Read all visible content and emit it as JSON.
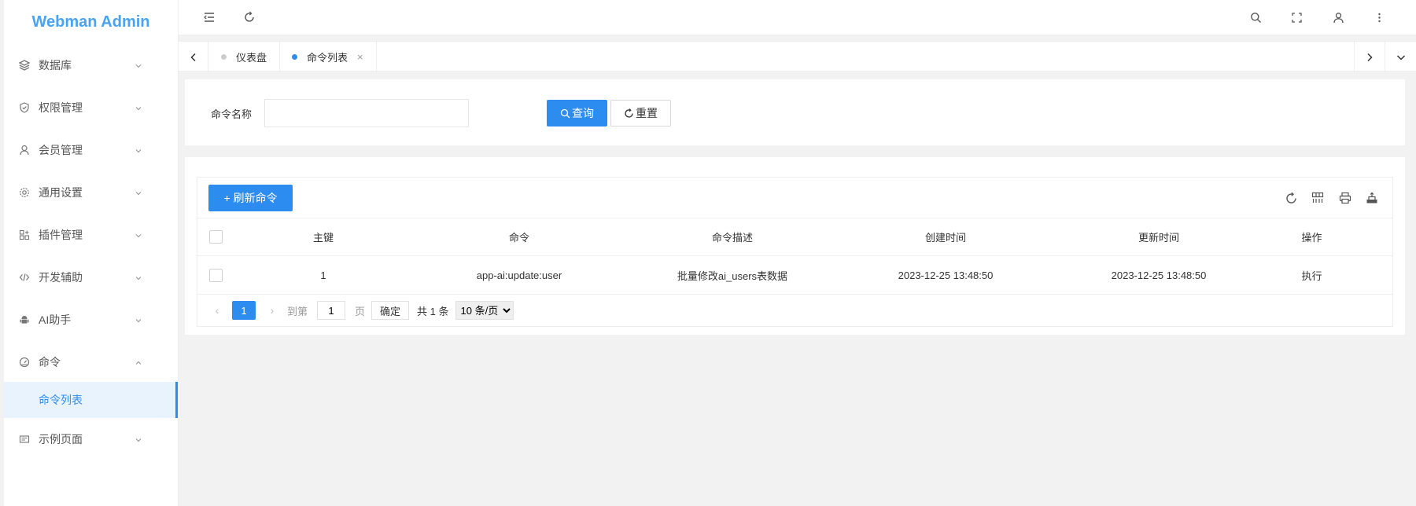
{
  "app": {
    "title": "Webman Admin"
  },
  "sidebar": {
    "items": [
      {
        "label": "数据库",
        "icon": "database-icon",
        "expanded": false
      },
      {
        "label": "权限管理",
        "icon": "shield-icon",
        "expanded": false
      },
      {
        "label": "会员管理",
        "icon": "user-icon",
        "expanded": false
      },
      {
        "label": "通用设置",
        "icon": "gear-icon",
        "expanded": false
      },
      {
        "label": "插件管理",
        "icon": "plugin-icon",
        "expanded": false
      },
      {
        "label": "开发辅助",
        "icon": "code-icon",
        "expanded": false
      },
      {
        "label": "AI助手",
        "icon": "android-icon",
        "expanded": false
      },
      {
        "label": "命令",
        "icon": "dashboard-icon",
        "expanded": true
      },
      {
        "label": "示例页面",
        "icon": "page-icon",
        "expanded": false
      }
    ],
    "active_sub": "命令列表"
  },
  "tabs": [
    {
      "label": "仪表盘",
      "active": false
    },
    {
      "label": "命令列表",
      "active": true,
      "close": "×"
    }
  ],
  "search": {
    "label": "命令名称",
    "value": "",
    "placeholder": "",
    "query_label": "查询",
    "reset_label": "重置"
  },
  "toolbar": {
    "refresh_label": "+ 刷新命令"
  },
  "table": {
    "columns": [
      "主键",
      "命令",
      "命令描述",
      "创建时间",
      "更新时间",
      "操作"
    ],
    "rows": [
      [
        "1",
        "app-ai:update:user",
        "批量修改ai_users表数据",
        "2023-12-25 13:48:50",
        "2023-12-25 13:48:50",
        "执行"
      ]
    ]
  },
  "pager": {
    "current": "1",
    "goto_label": "到第",
    "goto_value": "1",
    "page_suffix": "页",
    "confirm_label": "确定",
    "total_label": "共 1 条",
    "page_size": "10 条/页"
  },
  "colors": {
    "primary": "#2d8cf0",
    "logo": "#4aa3f0"
  }
}
